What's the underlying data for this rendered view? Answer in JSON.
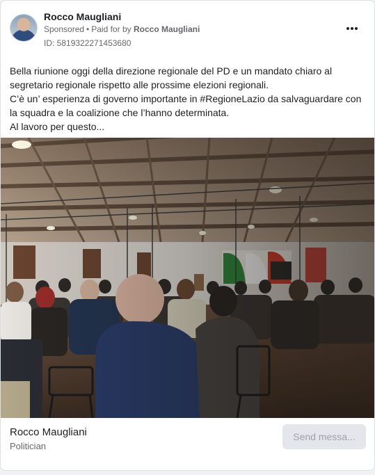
{
  "ad": {
    "page_name": "Rocco Maugliani",
    "sponsored_label": "Sponsored",
    "paid_for_prefix": "Paid for by",
    "paid_for_name": "Rocco Maugliani",
    "ad_id": "ID: 5819322271453680",
    "more_icon": "more-horizontal-icon"
  },
  "post": {
    "lines": [
      "Bella riunione oggi della direzione regionale del PD e un mandato chiaro al",
      "segretario regionale rispetto alle prossime elezioni regionali.",
      "C’è un’ esperienza di governo importante in #RegioneLazio da salvaguardare con",
      "la squadra e la coalizione che l’hanno determinata.",
      "Al lavoro per questo..."
    ]
  },
  "footer": {
    "name": "Rocco Maugliani",
    "role": "Politician",
    "send_button": "Send messa..."
  },
  "colors": {
    "text_primary": "#1c1e21",
    "text_secondary": "#65676b",
    "button_bg": "#e4e6eb",
    "button_text": "#9ea2a8"
  }
}
